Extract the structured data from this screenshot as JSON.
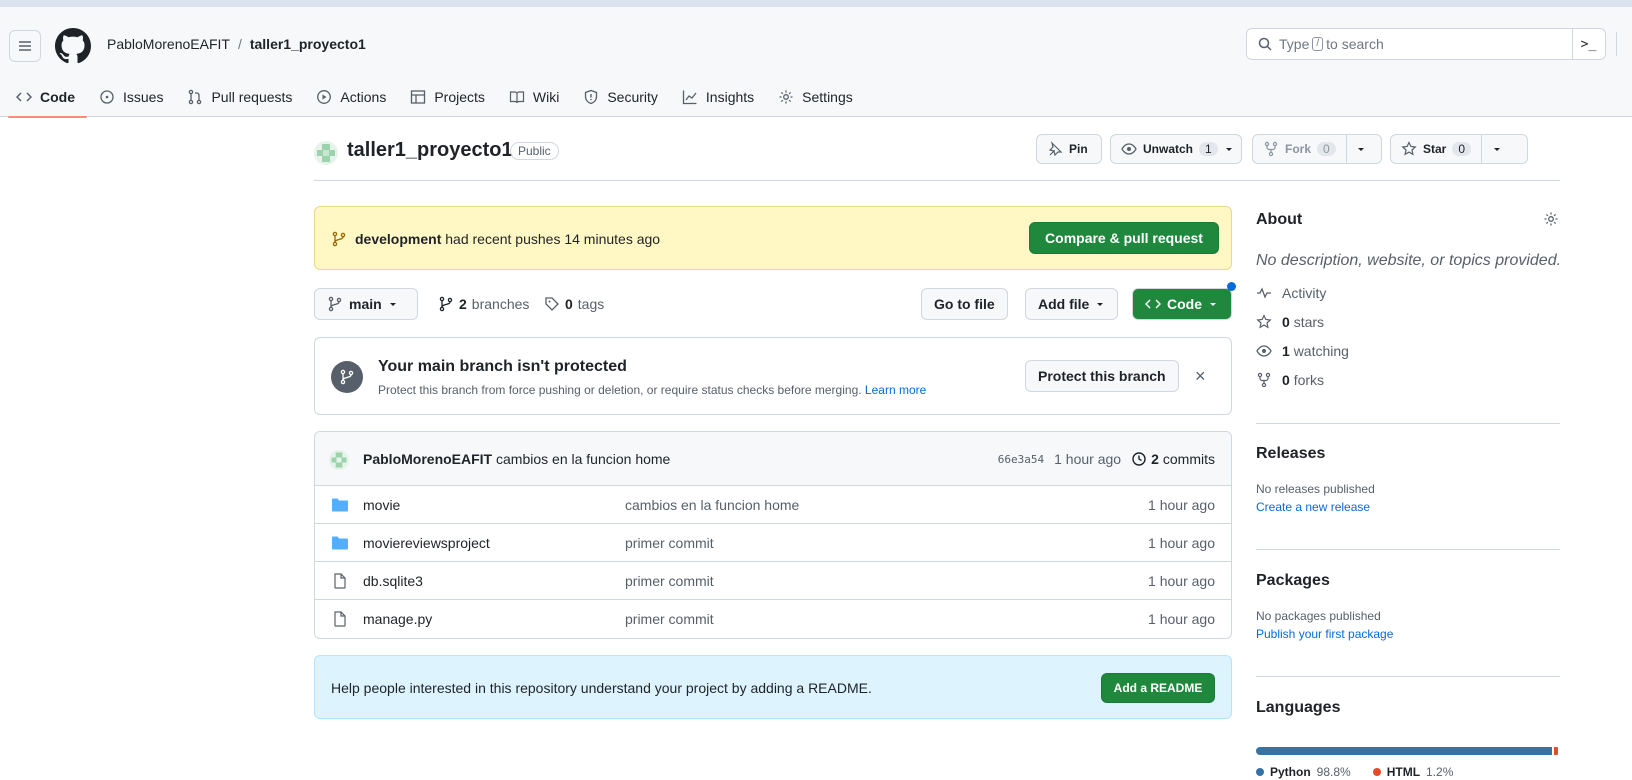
{
  "header": {
    "owner": "PabloMorenoEAFIT",
    "separator": "/",
    "repo": "taller1_proyecto1",
    "search_prefix": "Type",
    "search_key": "/",
    "search_suffix": "to search",
    "cmd_label": ">_"
  },
  "tabs": [
    {
      "label": "Code",
      "icon": "code-icon"
    },
    {
      "label": "Issues",
      "icon": "issue-icon"
    },
    {
      "label": "Pull requests",
      "icon": "pull-request-icon"
    },
    {
      "label": "Actions",
      "icon": "play-icon"
    },
    {
      "label": "Projects",
      "icon": "table-icon"
    },
    {
      "label": "Wiki",
      "icon": "book-icon"
    },
    {
      "label": "Security",
      "icon": "shield-icon"
    },
    {
      "label": "Insights",
      "icon": "graph-icon"
    },
    {
      "label": "Settings",
      "icon": "gear-icon"
    }
  ],
  "repo_header": {
    "name": "taller1_proyecto1",
    "visibility": "Public",
    "pin_label": "Pin",
    "unwatch_label": "Unwatch",
    "watch_count": "1",
    "fork_label": "Fork",
    "fork_count": "0",
    "star_label": "Star",
    "star_count": "0"
  },
  "push_banner": {
    "branch": "development",
    "text": "had recent pushes 14 minutes ago",
    "button": "Compare & pull request"
  },
  "toolbar": {
    "branch": "main",
    "branches_count": "2",
    "branches_label": "branches",
    "tags_count": "0",
    "tags_label": "tags",
    "go_to_file": "Go to file",
    "add_file": "Add file",
    "code": "Code"
  },
  "protect": {
    "title": "Your main branch isn't protected",
    "subtitle": "Protect this branch from force pushing or deletion, or require status checks before merging.",
    "learn_more": "Learn more",
    "button": "Protect this branch",
    "close": "×"
  },
  "latest_commit": {
    "author": "PabloMorenoEAFIT",
    "message": "cambios en la funcion home",
    "sha": "66e3a54",
    "time": "1 hour ago",
    "commits_count": "2",
    "commits_label": "commits"
  },
  "files": [
    {
      "name": "movie",
      "type": "folder",
      "message": "cambios en la funcion home",
      "time": "1 hour ago"
    },
    {
      "name": "moviereviewsproject",
      "type": "folder",
      "message": "primer commit",
      "time": "1 hour ago"
    },
    {
      "name": "db.sqlite3",
      "type": "file",
      "message": "primer commit",
      "time": "1 hour ago"
    },
    {
      "name": "manage.py",
      "type": "file",
      "message": "primer commit",
      "time": "1 hour ago"
    }
  ],
  "readme": {
    "text": "Help people interested in this repository understand your project by adding a README.",
    "button": "Add a README"
  },
  "sidebar": {
    "about_title": "About",
    "about_desc": "No description, website, or topics provided.",
    "activity": "Activity",
    "stars_count": "0",
    "stars_label": "stars",
    "watching_count": "1",
    "watching_label": "watching",
    "forks_count": "0",
    "forks_label": "forks",
    "releases_title": "Releases",
    "releases_none": "No releases published",
    "releases_link": "Create a new release",
    "packages_title": "Packages",
    "packages_none": "No packages published",
    "packages_link": "Publish your first package",
    "languages_title": "Languages",
    "languages": [
      {
        "name": "Python",
        "percent": "98.8%",
        "value": 98.8,
        "color": "#3572A5"
      },
      {
        "name": "HTML",
        "percent": "1.2%",
        "value": 1.2,
        "color": "#e34c26"
      }
    ]
  },
  "colors": {
    "accent_green": "#1f883d",
    "link_blue": "#0969da",
    "tab_underline": "#fd8c73",
    "banner_yellow": "#fff8c5",
    "readme_blue": "#ddf4ff"
  }
}
